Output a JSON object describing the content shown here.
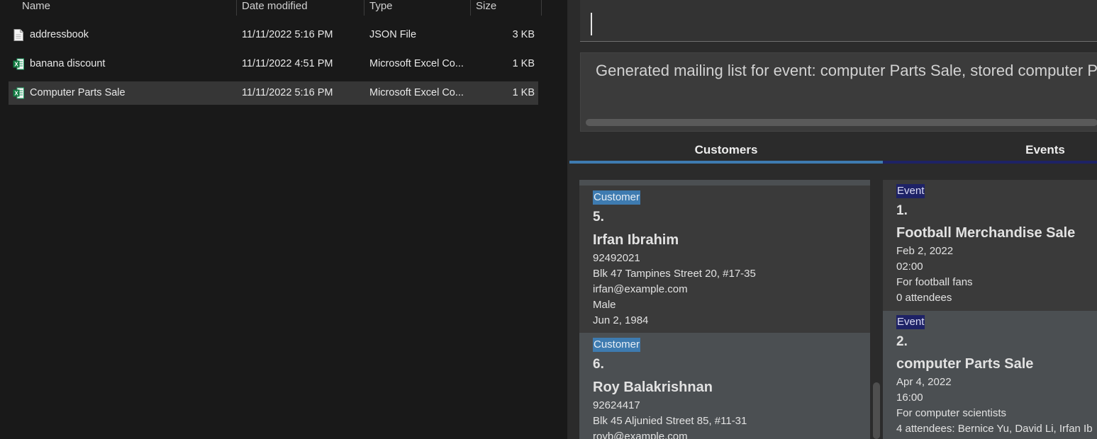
{
  "explorer": {
    "columns": {
      "name": "Name",
      "date": "Date modified",
      "type": "Type",
      "size": "Size"
    },
    "files": [
      {
        "name": "addressbook",
        "date": "11/11/2022 5:16 PM",
        "type": "JSON File",
        "size": "3 KB",
        "icon": "json-file-icon"
      },
      {
        "name": "banana discount",
        "date": "11/11/2022 4:51 PM",
        "type": "Microsoft Excel Co...",
        "size": "1 KB",
        "icon": "excel-file-icon"
      },
      {
        "name": "Computer Parts Sale",
        "date": "11/11/2022 5:16 PM",
        "type": "Microsoft Excel Co...",
        "size": "1 KB",
        "icon": "excel-file-icon",
        "selected": true
      }
    ]
  },
  "app": {
    "command_input": {
      "value": ""
    },
    "result": "Generated mailing list for event: computer Parts Sale, stored computer Parts Sa",
    "tabs": [
      {
        "label": "Customers",
        "selected": true
      },
      {
        "label": "Events",
        "selected": false
      }
    ],
    "customers": [
      {
        "tag": "Customer",
        "index": "5.",
        "name": "Irfan Ibrahim",
        "phone": "92492021",
        "address": "Blk 47 Tampines Street 20, #17-35",
        "email": "irfan@example.com",
        "gender": "Male",
        "birthday": "Jun 2, 1984"
      },
      {
        "tag": "Customer",
        "index": "6.",
        "name": "Roy Balakrishnan",
        "phone": "92624417",
        "address": "Blk 45 Aljunied Street 85, #11-31",
        "email": "royb@example.com"
      }
    ],
    "events": [
      {
        "tag": "Event",
        "index": "1.",
        "name": "Football Merchandise Sale",
        "date": "Feb 2, 2022",
        "time": "02:00",
        "description": "For football fans",
        "attendees": "0 attendees"
      },
      {
        "tag": "Event",
        "index": "2.",
        "name": "computer Parts Sale",
        "date": "Apr 4, 2022",
        "time": "16:00",
        "description": "For computer scientists",
        "attendees": "4 attendees: Bernice Yu, David Li, Irfan Ib"
      }
    ]
  },
  "colors": {
    "customer_badge": "#3e7bb0",
    "event_badge": "#1e2266",
    "tab_selected": "#3e7bb0",
    "tab_unselected": "#1e2266"
  }
}
